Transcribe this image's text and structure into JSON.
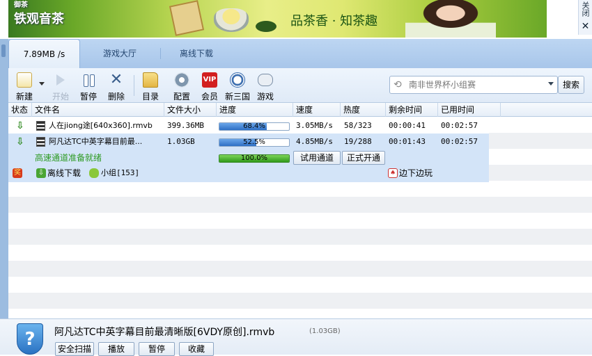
{
  "banner": {
    "logo_top": "御茶",
    "logo_main": "铁观音茶",
    "slogan": "品茶香 · 知茶趣"
  },
  "close_label": "关闭",
  "tabs": [
    {
      "label": "7.89MB /s"
    },
    {
      "label": "游戏大厅"
    },
    {
      "label": "离线下载"
    }
  ],
  "toolbar": {
    "new": "新建",
    "start": "开始",
    "pause": "暂停",
    "delete": "删除",
    "directory": "目录",
    "config": "配置",
    "vip_badge": "VIP",
    "member": "会员",
    "xinsanguo": "新三国",
    "games": "游戏"
  },
  "search": {
    "placeholder": "南非世界杯小组赛",
    "button": "搜索"
  },
  "columns": [
    "状态",
    "文件名",
    "文件大小",
    "进度",
    "速度",
    "热度",
    "剩余时间",
    "已用时间"
  ],
  "tasks": [
    {
      "name": "人在jiong途[640x360].rmvb",
      "size": "399.36MB",
      "progress_text": "68.4%",
      "progress": 0.684,
      "speed": "3.05MB/s",
      "heat": "58/323",
      "remaining": "00:00:41",
      "elapsed": "00:02:57"
    },
    {
      "name": "阿凡达TC中英字幕目前最...",
      "size": "1.03GB",
      "progress_text": "52.5%",
      "progress": 0.525,
      "speed": "4.85MB/s",
      "heat": "19/288",
      "remaining": "00:01:43",
      "elapsed": "00:02:57"
    }
  ],
  "channel": {
    "ready_text": "高速通道准备就绪",
    "progress_text": "100.0%",
    "progress": 1.0,
    "trial_button": "试用通道",
    "open_button": "正式开通"
  },
  "extras": {
    "offline_download": "离线下载",
    "group": "小组[153]",
    "play_while_download": "边下边玩"
  },
  "bottom": {
    "title": "阿凡达TC中英字幕目前最清晰版[6VDY原创].rmvb",
    "size": "(1.03GB)",
    "buttons": [
      "安全扫描",
      "播放",
      "暂停",
      "收藏"
    ]
  }
}
